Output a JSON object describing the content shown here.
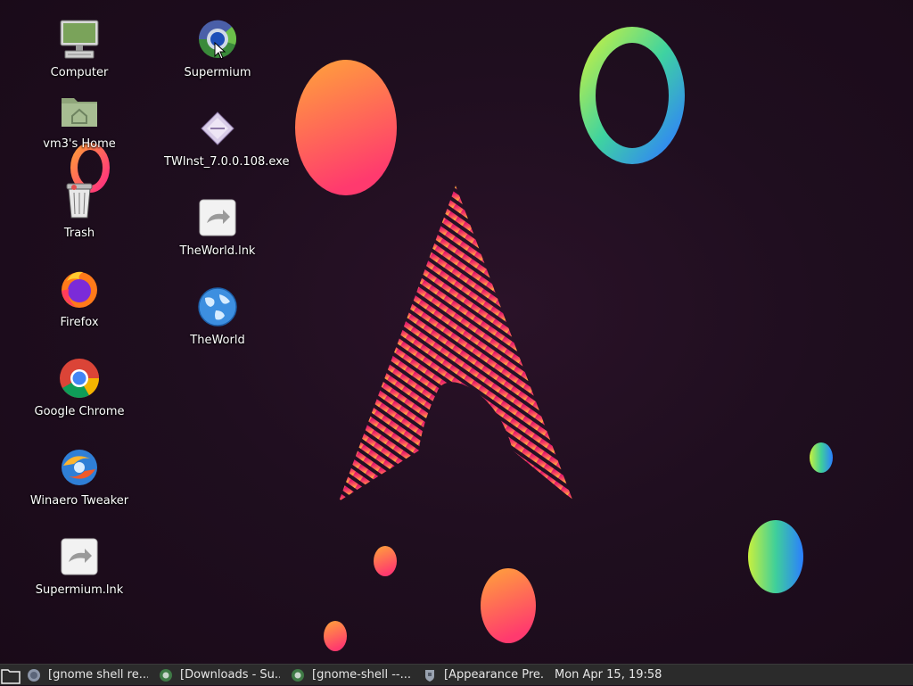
{
  "desktop": {
    "icons_col1": [
      {
        "label": "Computer"
      },
      {
        "label": "vm3's Home"
      },
      {
        "label": "Trash"
      },
      {
        "label": "Firefox"
      },
      {
        "label": "Google Chrome"
      },
      {
        "label": "Winaero Tweaker"
      },
      {
        "label": "Supermium.lnk"
      }
    ],
    "icons_col2": [
      {
        "label": "Supermium"
      },
      {
        "label": "TWInst_7.0.0.108.exe"
      },
      {
        "label": "TheWorld.lnk"
      },
      {
        "label": "TheWorld"
      }
    ]
  },
  "taskbar": {
    "tasks": [
      {
        "label": "[gnome shell re..."
      },
      {
        "label": "[Downloads - Su..."
      },
      {
        "label": "[gnome-shell --..."
      },
      {
        "label": "[Appearance Pre..."
      }
    ],
    "clock": "Mon Apr 15, 19:58"
  }
}
